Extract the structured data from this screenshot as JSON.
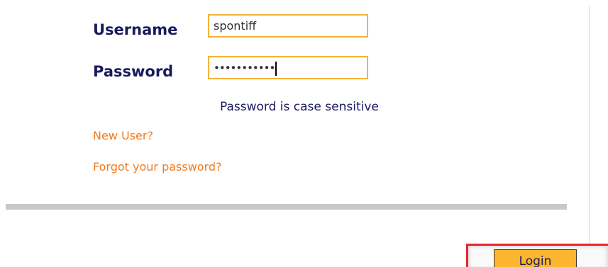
{
  "form": {
    "username_label": "Username",
    "username_value": "spontiff",
    "password_label": "Password",
    "password_masked": "•••••••••••",
    "password_hint": "Password is case sensitive"
  },
  "links": {
    "new_user": "New User?",
    "forgot_password": "Forgot your password?"
  },
  "actions": {
    "login_label": "Login"
  },
  "colors": {
    "label_navy": "#1a1a5e",
    "field_border": "#f5b335",
    "link_orange": "#f07b1f",
    "button_fill": "#fbb52e",
    "highlight_red": "#e8242c"
  }
}
